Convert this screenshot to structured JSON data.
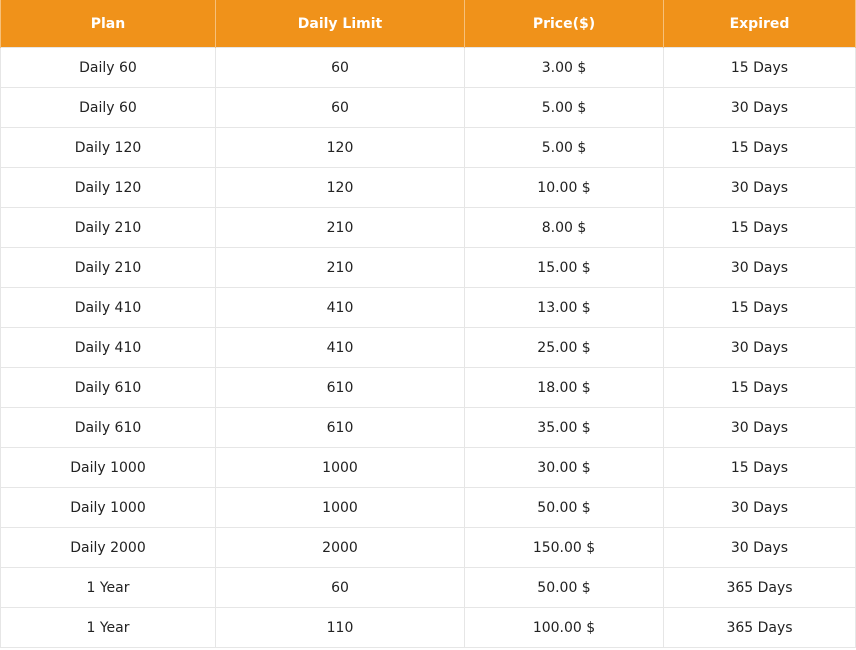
{
  "table": {
    "columns": [
      "Plan",
      "Daily Limit",
      "Price($)",
      "Expired"
    ],
    "rows": [
      [
        "Daily 60",
        "60",
        "3.00 $",
        "15 Days"
      ],
      [
        "Daily 60",
        "60",
        "5.00 $",
        "30 Days"
      ],
      [
        "Daily 120",
        "120",
        "5.00 $",
        "15 Days"
      ],
      [
        "Daily 120",
        "120",
        "10.00 $",
        "30 Days"
      ],
      [
        "Daily 210",
        "210",
        "8.00 $",
        "15 Days"
      ],
      [
        "Daily 210",
        "210",
        "15.00 $",
        "30 Days"
      ],
      [
        "Daily 410",
        "410",
        "13.00 $",
        "15 Days"
      ],
      [
        "Daily 410",
        "410",
        "25.00 $",
        "30 Days"
      ],
      [
        "Daily 610",
        "610",
        "18.00 $",
        "15 Days"
      ],
      [
        "Daily 610",
        "610",
        "35.00 $",
        "30 Days"
      ],
      [
        "Daily 1000",
        "1000",
        "30.00 $",
        "15 Days"
      ],
      [
        "Daily 1000",
        "1000",
        "50.00 $",
        "30 Days"
      ],
      [
        "Daily 2000",
        "2000",
        "150.00 $",
        "30 Days"
      ],
      [
        "1 Year",
        "60",
        "50.00 $",
        "365 Days"
      ],
      [
        "1 Year",
        "110",
        "100.00 $",
        "365 Days"
      ]
    ]
  },
  "colors": {
    "header_background": "#f0921a",
    "header_text": "#ffffff",
    "cell_border": "#e6e6e6"
  }
}
